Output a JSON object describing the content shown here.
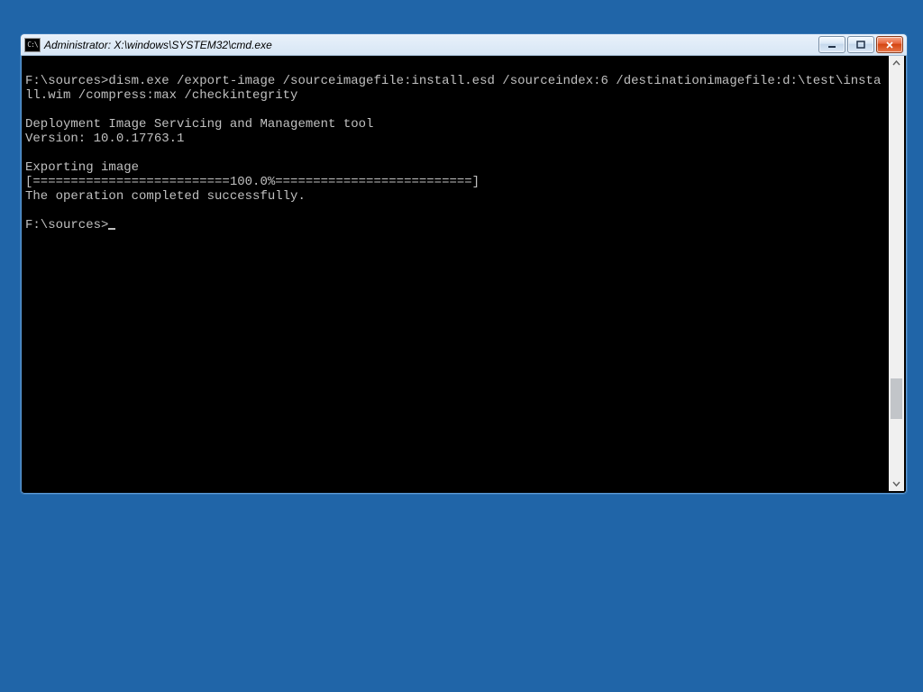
{
  "window": {
    "title": "Administrator: X:\\windows\\SYSTEM32\\cmd.exe",
    "icon_label": "C:\\"
  },
  "terminal": {
    "blank1": "",
    "cmdline": "F:\\sources>dism.exe /export-image /sourceimagefile:install.esd /sourceindex:6 /destinationimagefile:d:\\test\\install.wim /compress:max /checkintegrity",
    "blank2": "",
    "tool_name": "Deployment Image Servicing and Management tool",
    "version": "Version: 10.0.17763.1",
    "blank3": "",
    "exporting": "Exporting image",
    "progress": "[==========================100.0%==========================]",
    "success": "The operation completed successfully.",
    "blank4": "",
    "prompt": "F:\\sources>"
  },
  "scrollbar": {
    "thumb_top_pct": 76,
    "thumb_height_pct": 10
  }
}
